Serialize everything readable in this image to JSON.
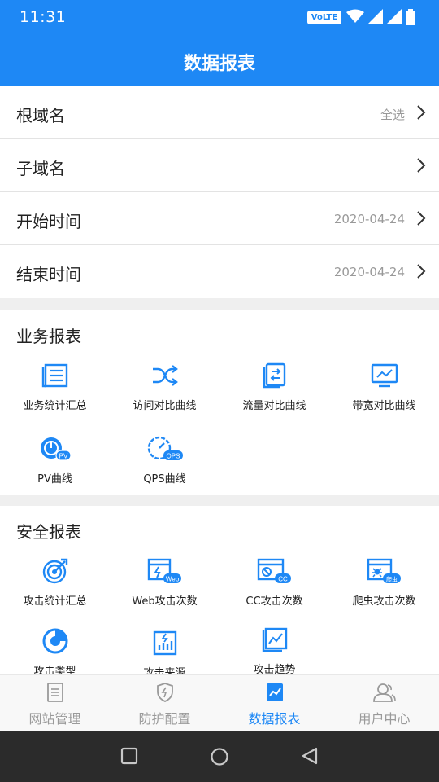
{
  "status": {
    "time": "11:31",
    "network_badge": "VoLTE 2"
  },
  "header": {
    "title": "数据报表"
  },
  "filters": [
    {
      "label": "根域名",
      "value": "全选"
    },
    {
      "label": "子域名",
      "value": ""
    },
    {
      "label": "开始时间",
      "value": "2020-04-24"
    },
    {
      "label": "结束时间",
      "value": "2020-04-24"
    }
  ],
  "business": {
    "title": "业务报表",
    "items": [
      {
        "label": "业务统计汇总",
        "icon": "list-report-icon"
      },
      {
        "label": "访问对比曲线",
        "icon": "shuffle-icon"
      },
      {
        "label": "流量对比曲线",
        "icon": "traffic-swap-icon"
      },
      {
        "label": "带宽对比曲线",
        "icon": "monitor-chart-icon"
      },
      {
        "label": "PV曲线",
        "icon": "pv-gauge-icon",
        "badge": "PV"
      },
      {
        "label": "QPS曲线",
        "icon": "qps-gauge-icon",
        "badge": "QPS"
      }
    ]
  },
  "security": {
    "title": "安全报表",
    "items": [
      {
        "label": "攻击统计汇总",
        "icon": "target-icon"
      },
      {
        "label": "Web攻击次数",
        "icon": "web-attack-icon",
        "badge": "Web"
      },
      {
        "label": "CC攻击次数",
        "icon": "cc-attack-icon",
        "badge": "CC"
      },
      {
        "label": "爬虫攻击次数",
        "icon": "crawler-attack-icon",
        "badge": "爬虫"
      },
      {
        "label": "攻击类型",
        "icon": "pie-chart-icon"
      },
      {
        "label": "攻击来源",
        "icon": "bar-source-icon"
      },
      {
        "label": "攻击趋势",
        "icon": "trend-icon"
      }
    ]
  },
  "tabs": [
    {
      "label": "网站管理",
      "icon": "document-icon",
      "active": false
    },
    {
      "label": "防护配置",
      "icon": "shield-icon",
      "active": false
    },
    {
      "label": "数据报表",
      "icon": "chart-icon",
      "active": true
    },
    {
      "label": "用户中心",
      "icon": "users-icon",
      "active": false
    }
  ],
  "colors": {
    "primary": "#1e88f5",
    "text": "#222222",
    "muted": "#999999",
    "tab_inactive": "#9a9a9a"
  }
}
